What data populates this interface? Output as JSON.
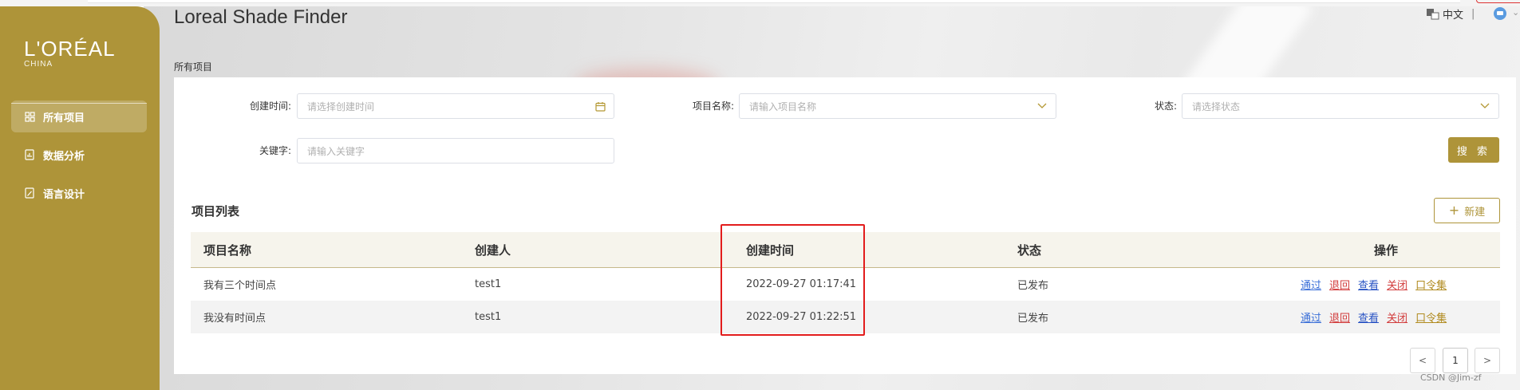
{
  "app": {
    "title": "Loreal Shade Finder",
    "breadcrumb": "所有项目",
    "language": "中文",
    "brand_color": "#ae9439"
  },
  "logo": {
    "brand": "L'ORÉAL",
    "sub": "CHINA"
  },
  "sidebar": {
    "items": [
      {
        "label": "所有项目",
        "icon": "grid-icon",
        "active": true
      },
      {
        "label": "数据分析",
        "icon": "document-chart-icon",
        "active": false
      },
      {
        "label": "语言设计",
        "icon": "document-edit-icon",
        "active": false
      }
    ]
  },
  "filters": {
    "created_time": {
      "label": "创建时间:",
      "placeholder": "请选择创建时间"
    },
    "project_name": {
      "label": "项目名称:",
      "placeholder": "请输入项目名称"
    },
    "status": {
      "label": "状态:",
      "placeholder": "请选择状态"
    },
    "keyword": {
      "label": "关键字:",
      "placeholder": "请输入关键字"
    },
    "search_label": "搜 索"
  },
  "list": {
    "title": "项目列表",
    "new_label": "新建",
    "columns": [
      "项目名称",
      "创建人",
      "创建时间",
      "状态",
      "操作"
    ],
    "rows": [
      {
        "name": "我有三个时间点",
        "creator": "test1",
        "created": "2022-09-27 01:17:41",
        "status": "已发布"
      },
      {
        "name": "我没有时间点",
        "creator": "test1",
        "created": "2022-09-27 01:22:51",
        "status": "已发布"
      }
    ],
    "actions": {
      "pass": "通过",
      "back": "退回",
      "view": "查看",
      "close": "关闭",
      "password_set": "口令集"
    }
  },
  "pagination": {
    "prev": "<",
    "current_page": "1",
    "next": ">"
  },
  "watermark": "CSDN @Jim-zf"
}
